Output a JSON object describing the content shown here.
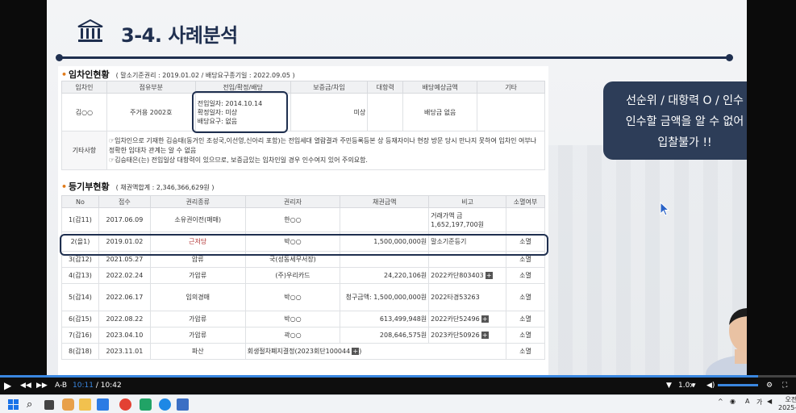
{
  "slide": {
    "title": "3-4. 사례분석",
    "callout_lines": [
      "선순위 / 대항력 O / 인수",
      "인수할 금액을 알 수 없어",
      "입찰불가 !!"
    ]
  },
  "tenant_section": {
    "heading": "임차인현황",
    "subheading": "( 말소기준권리 : 2019.01.02 / 배당요구종기일 : 2022.09.05 )",
    "columns": [
      "임차인",
      "점유부분",
      "전입/확정/배당",
      "보증금/차임",
      "대항력",
      "배당예상금액",
      "기타"
    ],
    "row": {
      "name": "김○○",
      "part": "주거용 2002호",
      "move_in": "전입일자: 2014.10.14",
      "fixed": "확정일자: 미상",
      "dividend": "배당요구: 없음",
      "deposit": "미상",
      "opposing": "",
      "expected": "배당금 없음",
      "etc": ""
    },
    "notes_label": "기타사항",
    "notes": [
      "☞임차인으로 기재한 김승태(동거인 조성국,이선영,신아리 포함)는 전입세대 열람결과 주민등록등본 상 등재자이나 현장 방문 당시 만나지 못하여 임차인 여부나 정확한 임대차 관계는 알 수 없음",
      "☞김승태은(는) 전입일상 대항력이 있으므로, 보증금있는 임차인일 경우 인수여지 있어 주의요함."
    ]
  },
  "registry_section": {
    "heading": "등기부현황",
    "subheading": "( 채권액합계 : 2,346,366,629원 )",
    "columns": [
      "No",
      "접수",
      "권리종류",
      "권리자",
      "채권금액",
      "비고",
      "소멸여부"
    ],
    "rows": [
      {
        "no": "1(갑11)",
        "date": "2017.06.09",
        "type": "소유권이전(매매)",
        "holder": "한○○",
        "amount": "",
        "note": "거래가액 금1,652,197,700원",
        "extinct": ""
      },
      {
        "no": "2(을1)",
        "date": "2019.01.02",
        "type": "근저당",
        "holder": "박○○",
        "amount": "1,500,000,000원",
        "note": "말소기준등기",
        "extinct": "소멸"
      },
      {
        "no": "3(갑12)",
        "date": "2021.05.27",
        "type": "압류",
        "holder": "국(성동세무서장)",
        "amount": "",
        "note": "",
        "extinct": "소멸"
      },
      {
        "no": "4(갑13)",
        "date": "2022.02.24",
        "type": "가압류",
        "holder": "(주)우리카드",
        "amount": "24,220,106원",
        "note": "2022카단803403",
        "extinct": "소멸"
      },
      {
        "no": "5(갑14)",
        "date": "2022.06.17",
        "type": "임의경매",
        "holder": "박○○",
        "amount": "청구금액: 1,500,000,000원",
        "note": "2022타경53263",
        "extinct": "소멸"
      },
      {
        "no": "6(갑15)",
        "date": "2022.08.22",
        "type": "가압류",
        "holder": "박○○",
        "amount": "613,499,948원",
        "note": "2022카단52496",
        "extinct": "소멸"
      },
      {
        "no": "7(갑16)",
        "date": "2023.04.10",
        "type": "가압류",
        "holder": "곽○○",
        "amount": "208,646,575원",
        "note": "2023카단50926",
        "extinct": "소멸"
      },
      {
        "no": "8(갑18)",
        "date": "2023.11.01",
        "type": "파산",
        "holder": "회생절차폐지결정(2023회단100044",
        "amount": "",
        "note": "",
        "extinct": "소멸"
      }
    ]
  },
  "player": {
    "ab": "A-B",
    "current_time": "10:11",
    "separator": "/",
    "total_time": "10:42",
    "progress": 0.952,
    "speed": "1.0x"
  },
  "taskbar": {
    "tray_time": "오전",
    "tray_date": "2025-",
    "lang": "A",
    "ime": "가"
  },
  "colors": {
    "accent": "#1f2f4f",
    "callout_bg": "#2d3d58",
    "progress": "#3a87e0",
    "bullet": "#e07b1a"
  }
}
